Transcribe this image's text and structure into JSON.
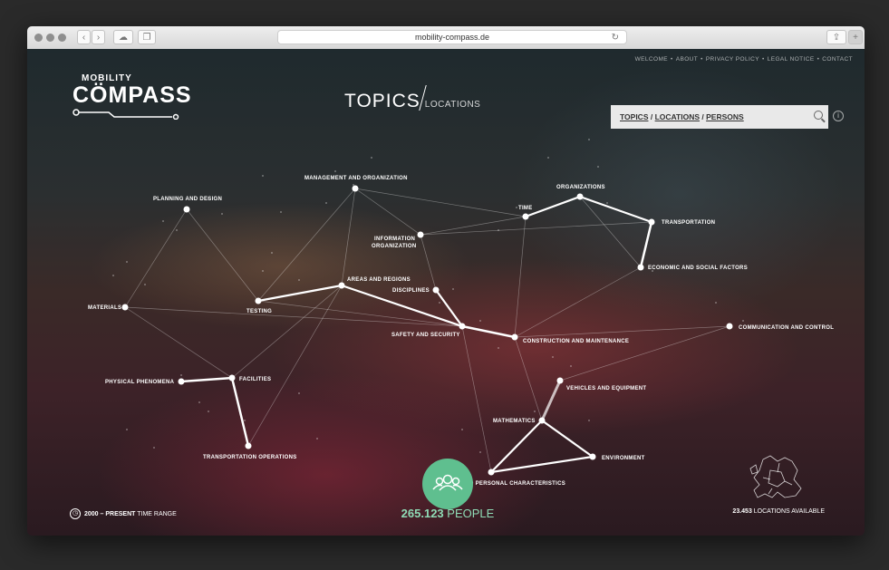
{
  "browser": {
    "url": "mobility-compass.de",
    "back_icon": "chevron-left-icon",
    "forward_icon": "chevron-right-icon",
    "cloud_icon": "cloud-icon",
    "tabs_icon": "tabs-icon",
    "reload_icon": "reload-icon",
    "share_icon": "share-icon",
    "newtab_icon": "plus-icon",
    "newtab_label": "+"
  },
  "topnav": [
    "WELCOME",
    "ABOUT",
    "PRIVACY POLICY",
    "LEGAL NOTICE",
    "CONTACT"
  ],
  "logo": {
    "top": "MOBILITY",
    "main": "CÖMPASS"
  },
  "heading": {
    "primary": "TOPICS",
    "secondary": "LOCATIONS"
  },
  "search": {
    "topics": "TOPICS",
    "locations": "LOCATIONS",
    "persons": "PERSONS",
    "sep": " / "
  },
  "info_label": "i",
  "graph": {
    "node_labels": {
      "management": "MANAGEMENT AND ORGANIZATION",
      "planning": "PLANNING AND DESIGN",
      "information1": "INFORMATION",
      "information2": "ORGANIZATION",
      "time": "TIME",
      "organizations": "ORGANIZATIONS",
      "transportation": "TRANSPORTATION",
      "economic": "ECONOMIC AND SOCIAL FACTORS",
      "areas": "AREAS AND REGIONS",
      "disciplines": "DISCIPLINES",
      "materials": "MATERIALS",
      "testing": "TESTING",
      "safety": "SAFETY AND SECURITY",
      "construction": "CONSTRUCTION AND MAINTENANCE",
      "communication": "COMMUNICATION AND CONTROL",
      "physical": "PHYSICAL PHENOMENA",
      "facilities": "FACILITIES",
      "vehicles": "VEHICLES AND EQUIPMENT",
      "mathematics": "MATHEMATICS",
      "environment": "ENVIRONMENT",
      "transport_ops": "TRANSPORTATION OPERATIONS",
      "personal_a": "PE",
      "personal_b": "D PERSONAL CHARACTERISTICS"
    }
  },
  "time_range": {
    "bold": "2000 – PRESENT",
    "rest": " TIME RANGE",
    "icon": "clock-icon"
  },
  "people": {
    "count": "265.123",
    "label": " PEOPLE",
    "icon": "people-icon"
  },
  "locations": {
    "count": "23.453",
    "label": " LOCATIONS AVAILABLE",
    "icon": "europe-map-icon"
  },
  "colors": {
    "accent": "#5fbf8f",
    "search_bg": "#e9e9e9"
  }
}
